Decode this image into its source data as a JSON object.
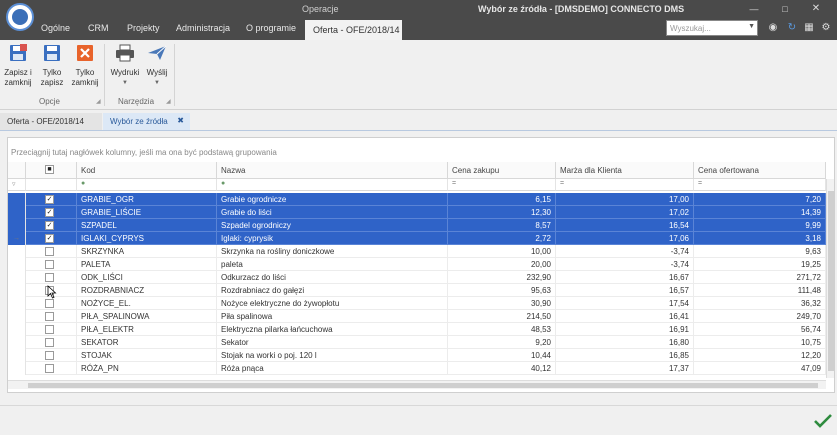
{
  "window": {
    "group_title": "Operacje",
    "title": "Wybór ze źródła - [DMSDEMO] CONNECTO DMS"
  },
  "menu": {
    "tabs": [
      "Ogólne",
      "CRM",
      "Projekty",
      "Administracja",
      "O programie"
    ],
    "active_tab": "Oferta - OFE/2018/14",
    "search_placeholder": "Wyszukaj..."
  },
  "ribbon": {
    "buttons": {
      "save_close": "Zapisz i zamknij",
      "save_only": "Tylko zapisz",
      "close_only": "Tylko zamknij",
      "prints": "Wydruki",
      "send": "Wyślij"
    },
    "groups": {
      "options": "Opcje",
      "tools": "Narzędzia"
    }
  },
  "doc_tabs": {
    "tab1": "Oferta - OFE/2018/14",
    "tab2": "Wybór ze źródła"
  },
  "grid": {
    "group_hint": "Przeciągnij tutaj nagłówek kolumny, jeśli ma ona być podstawą grupowania",
    "columns": {
      "kod": "Kod",
      "nazwa": "Nazwa",
      "cena_zakupu": "Cena zakupu",
      "marza": "Marża dla Klienta",
      "cena_ofertowana": "Cena ofertowana"
    },
    "filter_equals": "=",
    "rows": [
      {
        "kod": "GRABIE_OGR",
        "nazwa": "Grabie ogrodnicze",
        "cena_zakupu": "6,15",
        "marza": "17,00",
        "cena_ofertowana": "7,20",
        "checked": true,
        "selected": true,
        "current": false
      },
      {
        "kod": "GRABIE_LIŚCIE",
        "nazwa": "Grabie do liści",
        "cena_zakupu": "12,30",
        "marza": "17,02",
        "cena_ofertowana": "14,39",
        "checked": true,
        "selected": true,
        "current": false
      },
      {
        "kod": "SZPADEL",
        "nazwa": "Szpadel ogrodniczy",
        "cena_zakupu": "8,57",
        "marza": "16,54",
        "cena_ofertowana": "9,99",
        "checked": true,
        "selected": true,
        "current": false
      },
      {
        "kod": "IGLAKI_CYPRYS",
        "nazwa": "Iglaki: cyprysik",
        "cena_zakupu": "2,72",
        "marza": "17,06",
        "cena_ofertowana": "3,18",
        "checked": true,
        "selected": true,
        "current": true
      },
      {
        "kod": "SKRZYNKA",
        "nazwa": "Skrzynka na rośliny doniczkowe",
        "cena_zakupu": "10,00",
        "marza": "-3,74",
        "cena_ofertowana": "9,63",
        "checked": false,
        "selected": false,
        "current": false
      },
      {
        "kod": "PALETA",
        "nazwa": "paleta",
        "cena_zakupu": "20,00",
        "marza": "-3,74",
        "cena_ofertowana": "19,25",
        "checked": false,
        "selected": false,
        "current": false
      },
      {
        "kod": "ODK_LIŚCI",
        "nazwa": "Odkurzacz do liści",
        "cena_zakupu": "232,90",
        "marza": "16,67",
        "cena_ofertowana": "271,72",
        "checked": false,
        "selected": false,
        "current": false
      },
      {
        "kod": "ROZDRABNIACZ",
        "nazwa": "Rozdrabniacz do gałęzi",
        "cena_zakupu": "95,63",
        "marza": "16,57",
        "cena_ofertowana": "111,48",
        "checked": false,
        "selected": false,
        "current": false
      },
      {
        "kod": "NOŻYCE_EL.",
        "nazwa": "Nożyce elektryczne do żywopłotu",
        "cena_zakupu": "30,90",
        "marza": "17,54",
        "cena_ofertowana": "36,32",
        "checked": false,
        "selected": false,
        "current": false
      },
      {
        "kod": "PIŁA_SPALINOWA",
        "nazwa": "Piła spalinowa",
        "cena_zakupu": "214,50",
        "marza": "16,41",
        "cena_ofertowana": "249,70",
        "checked": false,
        "selected": false,
        "current": false
      },
      {
        "kod": "PIŁA_ELEKTR",
        "nazwa": "Elektryczna pilarka łańcuchowa",
        "cena_zakupu": "48,53",
        "marza": "16,91",
        "cena_ofertowana": "56,74",
        "checked": false,
        "selected": false,
        "current": false
      },
      {
        "kod": "SEKATOR",
        "nazwa": "Sekator",
        "cena_zakupu": "9,20",
        "marza": "16,80",
        "cena_ofertowana": "10,75",
        "checked": false,
        "selected": false,
        "current": false
      },
      {
        "kod": "STOJAK",
        "nazwa": "Stojak na worki o poj. 120 l",
        "cena_zakupu": "10,44",
        "marza": "16,85",
        "cena_ofertowana": "12,20",
        "checked": false,
        "selected": false,
        "current": false
      },
      {
        "kod": "RÓŻA_PN",
        "nazwa": "Róża pnąca",
        "cena_zakupu": "40,12",
        "marza": "17,37",
        "cena_ofertowana": "47,09",
        "checked": false,
        "selected": false,
        "current": false
      }
    ]
  },
  "colors": {
    "selection": "#2f63c8",
    "titlebar": "#4a4a4a",
    "accent_ok": "#2e8b3e"
  }
}
